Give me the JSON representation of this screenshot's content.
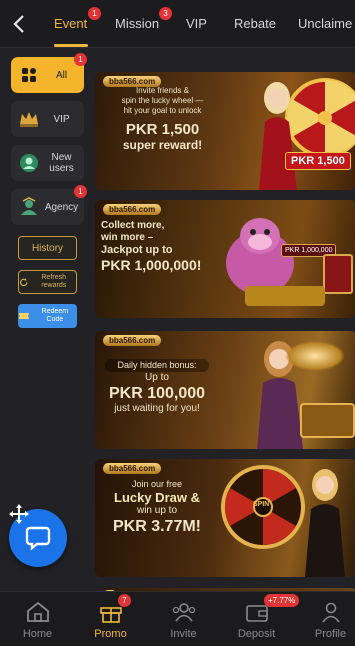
{
  "tabs": [
    {
      "label": "Event",
      "badge": "1",
      "active": true
    },
    {
      "label": "Mission",
      "badge": "3"
    },
    {
      "label": "VIP"
    },
    {
      "label": "Rebate"
    },
    {
      "label": "Unclaime"
    }
  ],
  "sidebar": {
    "items": [
      {
        "label": "All",
        "badge": "1",
        "icon": "grid-icon",
        "active": true
      },
      {
        "label": "VIP",
        "icon": "vip-crown-icon"
      },
      {
        "label": "New users",
        "icon": "new-user-icon"
      },
      {
        "label": "Agency",
        "badge": "1",
        "icon": "agency-icon"
      }
    ],
    "history_label": "History",
    "refresh_label": "Refresh rewards",
    "redeem_label": "Redeem Code"
  },
  "banners": [
    {
      "logo": "bba566.com",
      "line1": "Invite friends &",
      "line2": "spin the lucky wheel —",
      "line3": "hit your goal to unlock",
      "big": "PKR 1,500",
      "line4": "super reward!",
      "tag": "PKR 1,500"
    },
    {
      "logo": "bba566.com",
      "line1": "Collect more,",
      "line2": "win more –",
      "line3": "Jackpot up to",
      "big": "PKR 1,000,000!",
      "tag": "PKR 1,000,000"
    },
    {
      "logo": "bba566.com",
      "line1": "Daily hidden bonus:",
      "line2": "Up to",
      "big": "PKR 100,000",
      "line3": "just waiting for you!"
    },
    {
      "logo": "bba566.com",
      "line1": "Join our free",
      "line2": "Lucky Draw &",
      "line3": "win up to",
      "big": "PKR 3.77M!",
      "tag": "SPIN"
    }
  ],
  "bottom_nav": [
    {
      "label": "Home",
      "icon": "home-icon"
    },
    {
      "label": "Promo",
      "icon": "gift-icon",
      "badge": "7",
      "active": true
    },
    {
      "label": "Invite",
      "icon": "invite-icon"
    },
    {
      "label": "Deposit",
      "icon": "wallet-icon",
      "badge": "+7.77%"
    },
    {
      "label": "Profile",
      "icon": "profile-icon"
    }
  ],
  "colors": {
    "accent": "#f0b73a",
    "badge": "#e23434",
    "chat": "#1a73e8",
    "redeem": "#3c8fe8"
  }
}
